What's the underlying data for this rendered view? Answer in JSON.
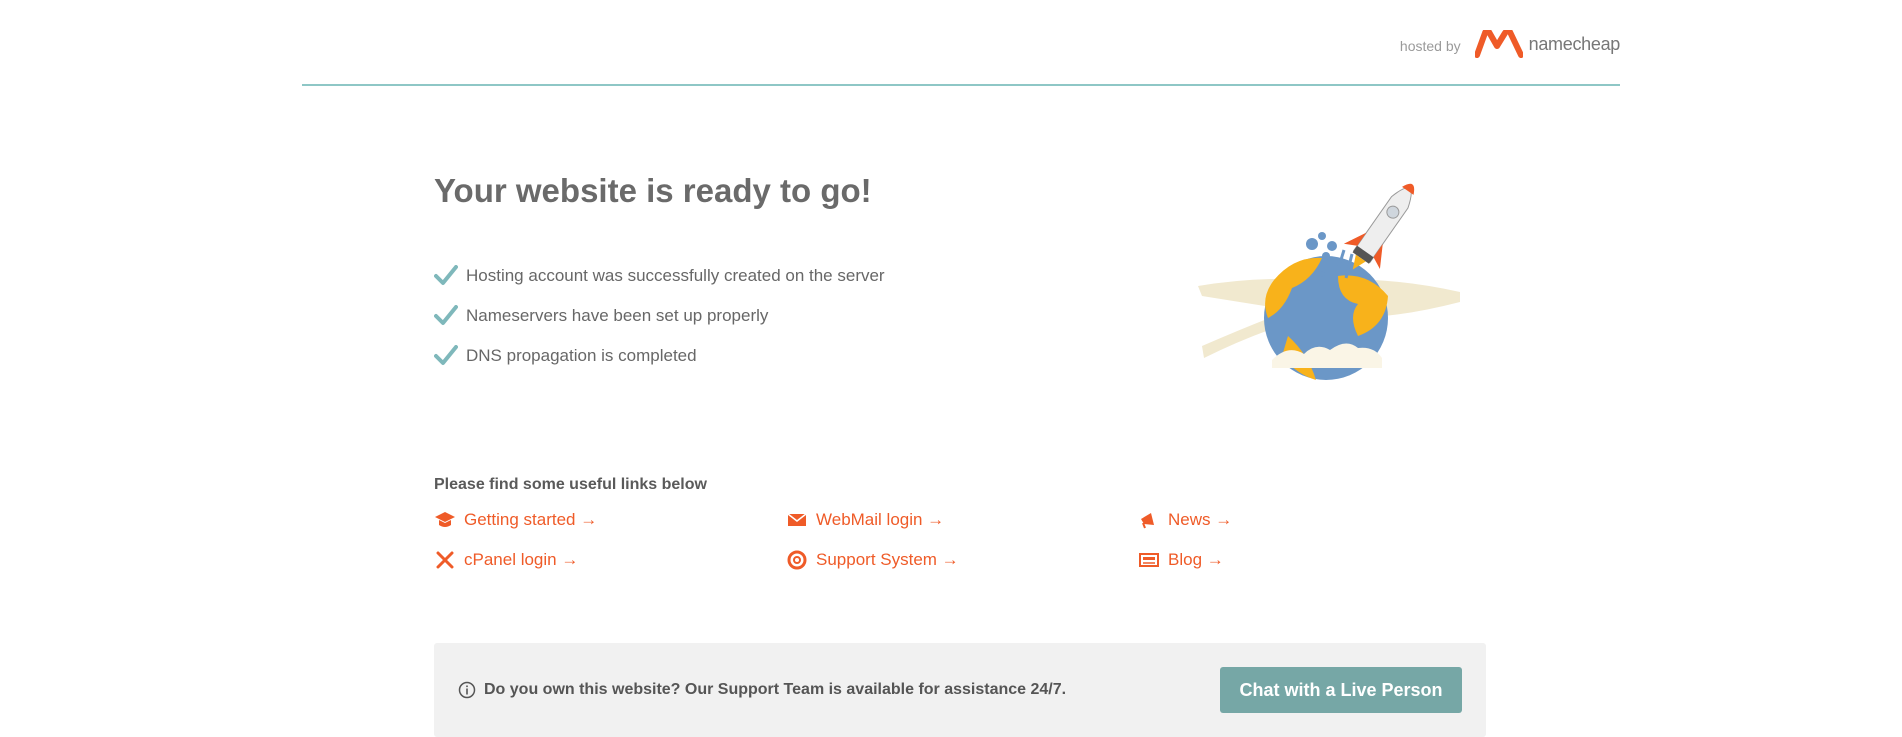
{
  "header": {
    "hosted_by": "hosted by",
    "brand_name": "namecheap"
  },
  "main": {
    "title": "Your website is ready to go!",
    "checklist": [
      "Hosting account was successfully created on the server",
      "Nameservers have been set up properly",
      "DNS propagation is completed"
    ]
  },
  "links": {
    "title": "Please find some useful links below",
    "items": [
      {
        "label": "Getting started →",
        "icon": "graduation-cap-icon"
      },
      {
        "label": "cPanel login →",
        "icon": "tools-icon"
      },
      {
        "label": "WebMail login →",
        "icon": "envelope-icon"
      },
      {
        "label": "Support System →",
        "icon": "lifebuoy-icon"
      },
      {
        "label": "News →",
        "icon": "megaphone-icon"
      },
      {
        "label": "Blog →",
        "icon": "newspaper-icon"
      }
    ]
  },
  "support": {
    "text": "Do you own this website? Our Support Team is available for assistance 24/7.",
    "button_label": "Chat with a Live Person"
  },
  "colors": {
    "accent": "#ef5b28",
    "teal": "#8ec7c6",
    "button": "#76a7a6",
    "check": "#7fb8bb",
    "text": "#5e5e5e"
  }
}
